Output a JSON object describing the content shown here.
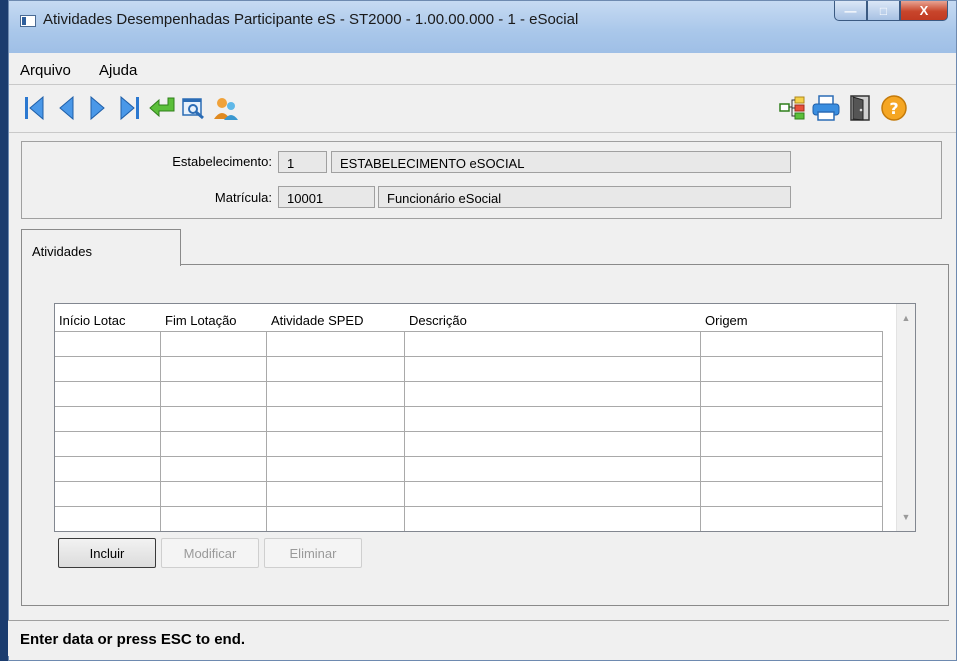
{
  "window": {
    "title": "Atividades Desempenhadas Participante eS - ST2000 - 1.00.00.000 - 1 - eSocial",
    "minimize_glyph": "—",
    "maximize_glyph": "□",
    "close_glyph": "X"
  },
  "menu": {
    "arquivo": "Arquivo",
    "ajuda": "Ajuda"
  },
  "toolbar": {
    "left_icons": [
      "first-record-icon",
      "previous-record-icon",
      "next-record-icon",
      "last-record-icon",
      "go-to-icon",
      "search-icon",
      "users-icon"
    ],
    "right_icons": [
      "tree-structure-icon",
      "print-icon",
      "exit-door-icon",
      "help-icon"
    ],
    "help_glyph": "?"
  },
  "header": {
    "estabelecimento_label": "Estabelecimento:",
    "estabelecimento_code": "1",
    "estabelecimento_name": "ESTABELECIMENTO eSOCIAL",
    "matricula_label": "Matrícula:",
    "matricula_code": "10001",
    "matricula_name": "Funcionário eSocial"
  },
  "tabs": {
    "atividades": "Atividades"
  },
  "table": {
    "columns": [
      "Início Lotac",
      "Fim Lotação",
      "Atividade SPED",
      "Descrição",
      "Origem"
    ],
    "rows": [],
    "scroll_up": "▲",
    "scroll_down": "▼"
  },
  "buttons": {
    "incluir": "Incluir",
    "modificar": "Modificar",
    "eliminar": "Eliminar"
  },
  "status": "Enter data or press ESC to end.",
  "colors": {
    "title_bar": "#a9c7ea",
    "close_button": "#c8452b",
    "window_bg": "#f0f0f0"
  }
}
